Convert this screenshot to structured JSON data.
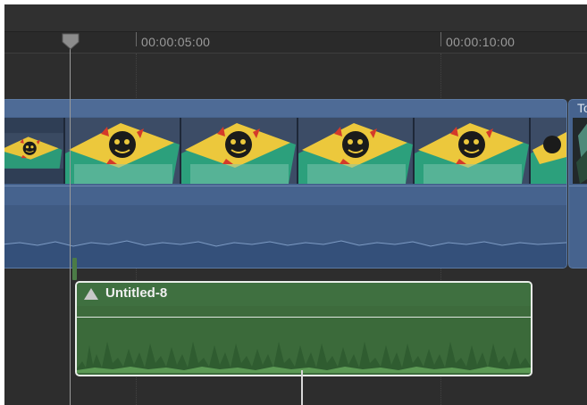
{
  "ruler": {
    "timecodes": [
      "00:00:05:00",
      "00:00:10:00"
    ]
  },
  "timeline": {
    "primary_clip": {
      "frame_count": 6
    },
    "next_clip": {
      "label": "To"
    },
    "connected_audio_clip": {
      "label": "Untitled-8"
    }
  },
  "colors": {
    "video_clip": "#46638e",
    "audio_clip": "#3d6b3c",
    "background": "#2e2e2e"
  },
  "icons": {
    "audio_clip": "speaker-cone-icon",
    "playhead": "playhead-icon"
  }
}
